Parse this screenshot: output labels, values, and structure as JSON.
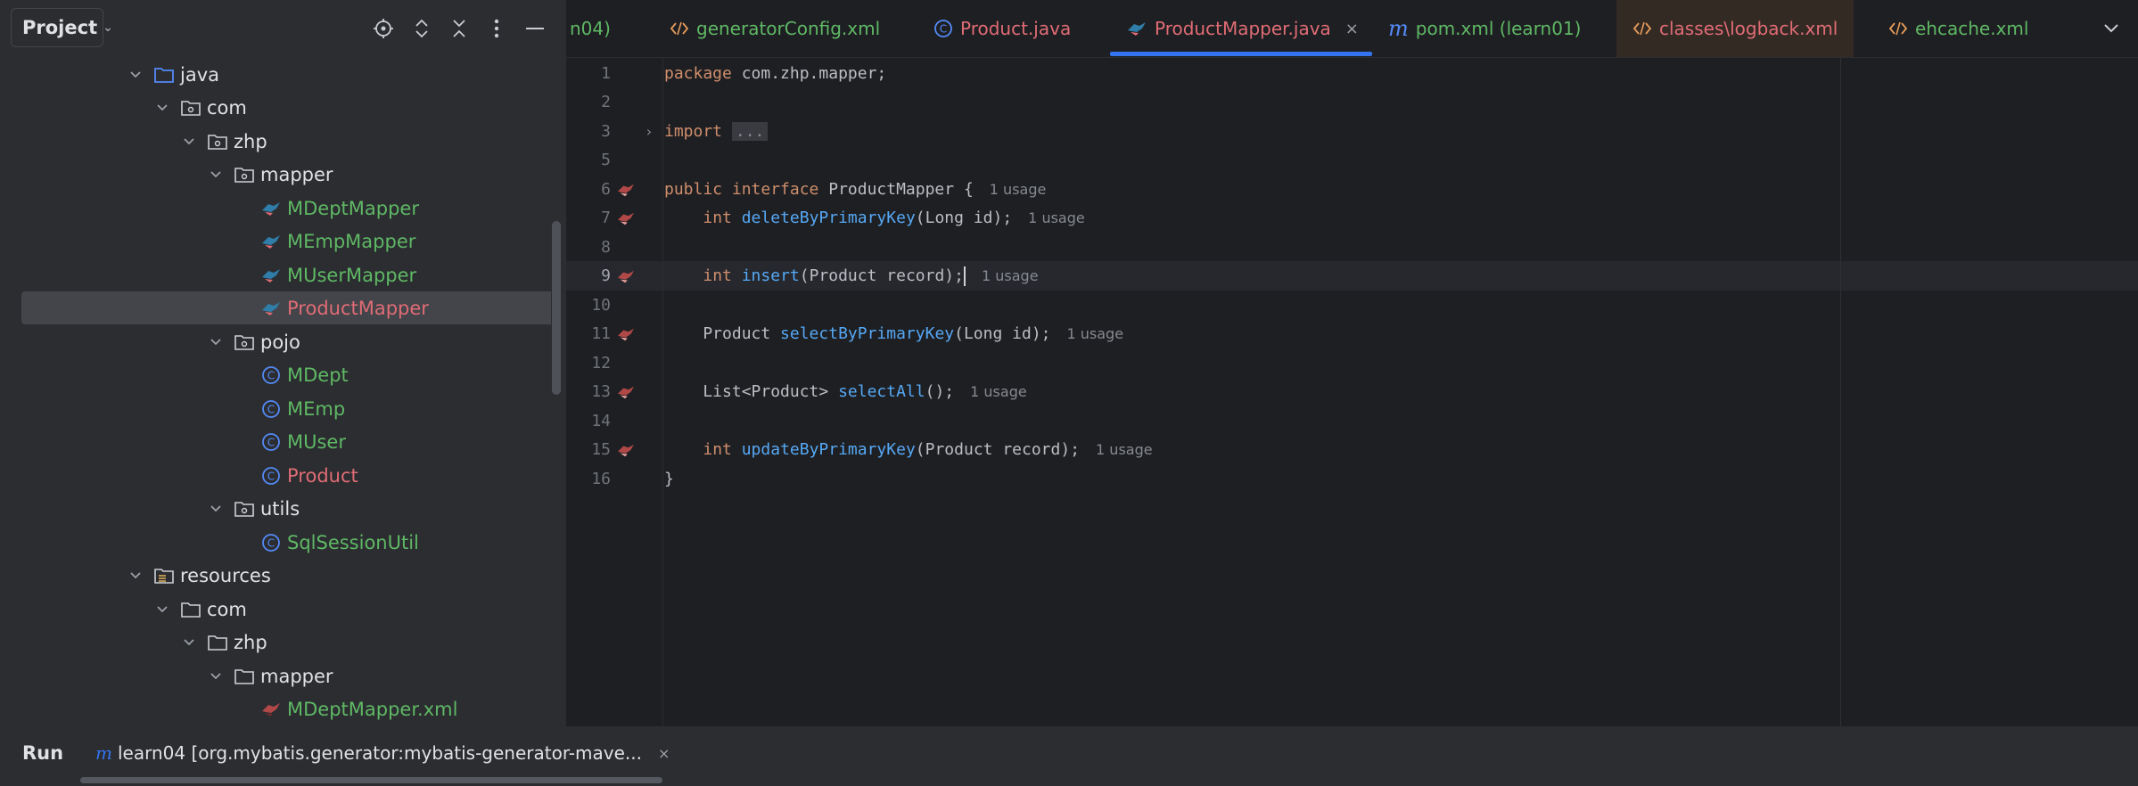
{
  "project_panel": {
    "title": "Project",
    "tree": [
      {
        "label": "java",
        "type": "source-folder",
        "expanded": true
      },
      {
        "label": "com",
        "type": "package",
        "expanded": true
      },
      {
        "label": "zhp",
        "type": "package",
        "expanded": true
      },
      {
        "label": "mapper",
        "type": "package",
        "expanded": true
      },
      {
        "label": "MDeptMapper",
        "type": "mybatis-interface",
        "color": "green"
      },
      {
        "label": "MEmpMapper",
        "type": "mybatis-interface",
        "color": "green"
      },
      {
        "label": "MUserMapper",
        "type": "mybatis-interface",
        "color": "green"
      },
      {
        "label": "ProductMapper",
        "type": "mybatis-interface",
        "color": "red",
        "selected": true
      },
      {
        "label": "pojo",
        "type": "package",
        "expanded": true
      },
      {
        "label": "MDept",
        "type": "class",
        "color": "green"
      },
      {
        "label": "MEmp",
        "type": "class",
        "color": "green"
      },
      {
        "label": "MUser",
        "type": "class",
        "color": "green"
      },
      {
        "label": "Product",
        "type": "class",
        "color": "red"
      },
      {
        "label": "utils",
        "type": "package",
        "expanded": true
      },
      {
        "label": "SqlSessionUtil",
        "type": "class",
        "color": "green"
      },
      {
        "label": "resources",
        "type": "resources-folder",
        "expanded": true
      },
      {
        "label": "com",
        "type": "folder",
        "expanded": true
      },
      {
        "label": "zhp",
        "type": "folder",
        "expanded": true
      },
      {
        "label": "mapper",
        "type": "folder",
        "expanded": true
      },
      {
        "label": "MDeptMapper.xml",
        "type": "mybatis-xml",
        "color": "green"
      }
    ]
  },
  "tabs": [
    {
      "label": "n04)",
      "icon": "none",
      "color": "green"
    },
    {
      "label": "generatorConfig.xml",
      "icon": "xml-icon",
      "color": "green"
    },
    {
      "label": "Product.java",
      "icon": "class-icon",
      "color": "red"
    },
    {
      "label": "ProductMapper.java",
      "icon": "mybatis-icon",
      "color": "red",
      "active": true,
      "closable": true
    },
    {
      "label": "pom.xml (learn01)",
      "icon": "maven-icon",
      "color": "green"
    },
    {
      "label": "classes\\logback.xml",
      "icon": "xml-icon",
      "color": "red"
    },
    {
      "label": "ehcache.xml",
      "icon": "xml-icon",
      "color": "green"
    }
  ],
  "editor": {
    "usage_hint": "1 usage",
    "lines": [
      {
        "n": "1",
        "text": "package com.zhp.mapper;"
      },
      {
        "n": "2",
        "text": ""
      },
      {
        "n": "3",
        "text": "import ..."
      },
      {
        "n": "5",
        "text": ""
      },
      {
        "n": "6",
        "text": "public interface ProductMapper {"
      },
      {
        "n": "7",
        "text": "int deleteByPrimaryKey(Long id);"
      },
      {
        "n": "8",
        "text": ""
      },
      {
        "n": "9",
        "text": "int insert(Product record);"
      },
      {
        "n": "10",
        "text": ""
      },
      {
        "n": "11",
        "text": "Product selectByPrimaryKey(Long id);"
      },
      {
        "n": "12",
        "text": ""
      },
      {
        "n": "13",
        "text": "List<Product> selectAll();"
      },
      {
        "n": "14",
        "text": ""
      },
      {
        "n": "15",
        "text": "int updateByPrimaryKey(Product record);"
      },
      {
        "n": "16",
        "text": "}"
      }
    ]
  },
  "bottom": {
    "run_label": "Run",
    "run_tab_icon": "m",
    "run_tab_label": "learn04 [org.mybatis.generator:mybatis-generator-mave..."
  },
  "colors": {
    "accent": "#3574f0",
    "vcs_added": "#5fb865",
    "vcs_modified": "#e06c75",
    "keyword": "#cf8e6d",
    "method": "#56a8f5"
  }
}
